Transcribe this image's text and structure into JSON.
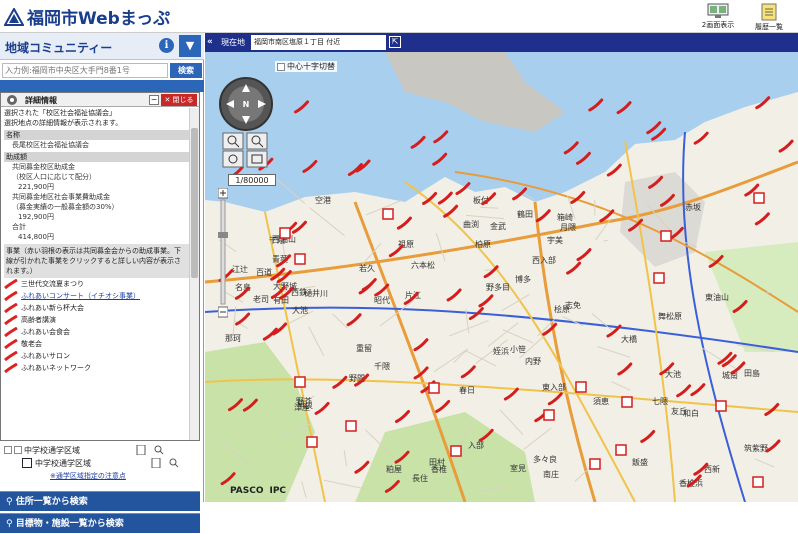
{
  "app": {
    "title": "福岡市Webまっぷ"
  },
  "toolbar": {
    "dual_label": "2画面表示",
    "history_label": "履歴一覧"
  },
  "sidebar": {
    "panel_title": "地域コミュニティー",
    "info_glyph": "i",
    "dropdown_glyph": "▼",
    "search": {
      "placeholder": "入力例:福岡市中央区大手門8番1号",
      "button": "検索"
    }
  },
  "detail": {
    "title": "詳細情報",
    "minimize": "−",
    "close": "✕ 閉じる",
    "lines": {
      "l1": "選択された「校区社会福祉協議会」",
      "l2": "選択地点の詳細情報が表示されます。",
      "name_header": "名称",
      "name_value": "長尾校区社会福祉協議会",
      "grant_header": "助成額",
      "g1": "共同募金校区助成金",
      "g2": "（校区人口に応じて配分）",
      "g3": "221,900円",
      "g4": "共同募金地区社会事業費助成金",
      "g5": "（募金実績の一般募金額の30%）",
      "g6": "192,900円",
      "g7": "合計",
      "g8": "414,800円",
      "note": "事業（赤い羽根の表示は共同募金会からの助成事業。下線が引かれた事業をクリックすると詳しい内容が表示されます。）"
    },
    "items": [
      {
        "label": "三世代交流夏まつり",
        "link": false
      },
      {
        "label": "ふれあいコンサート（イチオシ事業）",
        "link": true
      },
      {
        "label": "ふれあい新ら杯大会",
        "link": false
      },
      {
        "label": "高齢者講演",
        "link": false
      },
      {
        "label": "ふれあい会食会",
        "link": false
      },
      {
        "label": "敬老会",
        "link": false
      },
      {
        "label": "ふれあいサロン",
        "link": false
      },
      {
        "label": "ふれあいネットワーク",
        "link": false
      }
    ]
  },
  "tree": {
    "row1": "中学校通学区域",
    "row2": "中学校通学区域",
    "row3": "※通学区域指定の注意点"
  },
  "actions": {
    "address_list": "住所一覧から検索",
    "landmark_list": "目標物・施設一覧から検索"
  },
  "mapbar": {
    "collapse": "«",
    "current_label": "現在地",
    "current_value": "福岡市南区塩原１丁目 付近",
    "expand": "⇱"
  },
  "map": {
    "center_cross": "中心十字切替",
    "scale": "1/80000",
    "compass": "N",
    "copyright": [
      "PASCO",
      "IPC"
    ],
    "place_labels": [
      "津屋",
      "赤坂",
      "博多",
      "六本松",
      "大橋",
      "野間",
      "西新",
      "香椎",
      "舞松原",
      "青葉",
      "早良",
      "南庄",
      "昭代",
      "祖原",
      "城南",
      "七隈",
      "千隈",
      "野芥",
      "田島",
      "片江",
      "内野",
      "大池",
      "友丘",
      "小笹",
      "桧原",
      "西油山",
      "田村",
      "飯盛",
      "入部",
      "曲渕",
      "東油山",
      "若久",
      "老司",
      "長住",
      "大池",
      "鶴田",
      "柏原",
      "野多目",
      "重留",
      "西入部",
      "東入部",
      "金武",
      "那珂",
      "板付",
      "月隈",
      "大野城",
      "春日",
      "筑紫野",
      "空港",
      "香椎浜",
      "和白",
      "多々良",
      "名島",
      "箱崎",
      "志免",
      "粕屋",
      "宇美",
      "須恵",
      "江辻",
      "西鉄",
      "百道",
      "姪浜",
      "室見",
      "有田",
      "干隈",
      "樋井川"
    ]
  },
  "colors": {
    "header_blue": "#1a3e8c",
    "panel_blue": "#2c66b8",
    "bar_blue": "#1f2f8c",
    "close_red": "#c82828",
    "sea": "#a9cfee",
    "land": "#f2efe6",
    "green": "#c8e2a8"
  }
}
